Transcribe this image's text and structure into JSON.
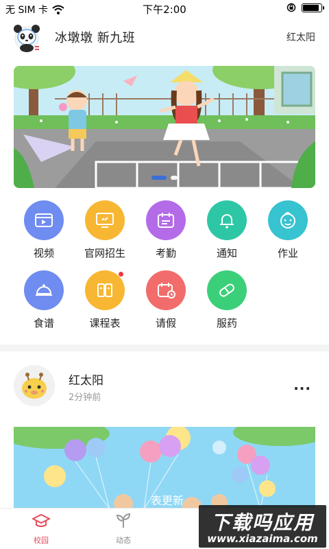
{
  "status_bar": {
    "carrier": "无 SIM 卡",
    "time": "下午2:00",
    "battery_level": 0.9
  },
  "header": {
    "title": "冰墩墩  新九班",
    "user": "红太阳",
    "avatar_icon": "panda-avatar-icon"
  },
  "banner": {
    "slide_count": 2,
    "active_slide": 1
  },
  "grid": {
    "items": [
      {
        "label": "视频",
        "icon": "video-icon",
        "color": "#6f8cf0"
      },
      {
        "label": "官网招生",
        "icon": "monitor-icon",
        "color": "#f7b733"
      },
      {
        "label": "考勤",
        "icon": "calendar-icon",
        "color": "#b46be8"
      },
      {
        "label": "通知",
        "icon": "bell-icon",
        "color": "#2ec7a6"
      },
      {
        "label": "作业",
        "icon": "child-face-icon",
        "color": "#37c3cf"
      },
      {
        "label": "食谱",
        "icon": "dish-icon",
        "color": "#6f8cf0"
      },
      {
        "label": "课程表",
        "icon": "book-icon",
        "color": "#f7b733",
        "badge": true
      },
      {
        "label": "请假",
        "icon": "leave-calendar-icon",
        "color": "#f26c6c"
      },
      {
        "label": "服药",
        "icon": "pill-icon",
        "color": "#3ccf7a"
      }
    ]
  },
  "post": {
    "name": "红太阳",
    "time": "2分钟前",
    "more": "···",
    "image_caption": "表更新"
  },
  "tabs": [
    {
      "label": "校园",
      "icon": "graduation-cap-icon",
      "active": true
    },
    {
      "label": "动态",
      "icon": "sprout-icon",
      "active": false
    }
  ],
  "watermark": {
    "main": "下载吗应用",
    "sub": "www.xiazaima.com"
  },
  "colors": {
    "accent": "#e64a5a",
    "dot_active": "#3b6fd8"
  }
}
